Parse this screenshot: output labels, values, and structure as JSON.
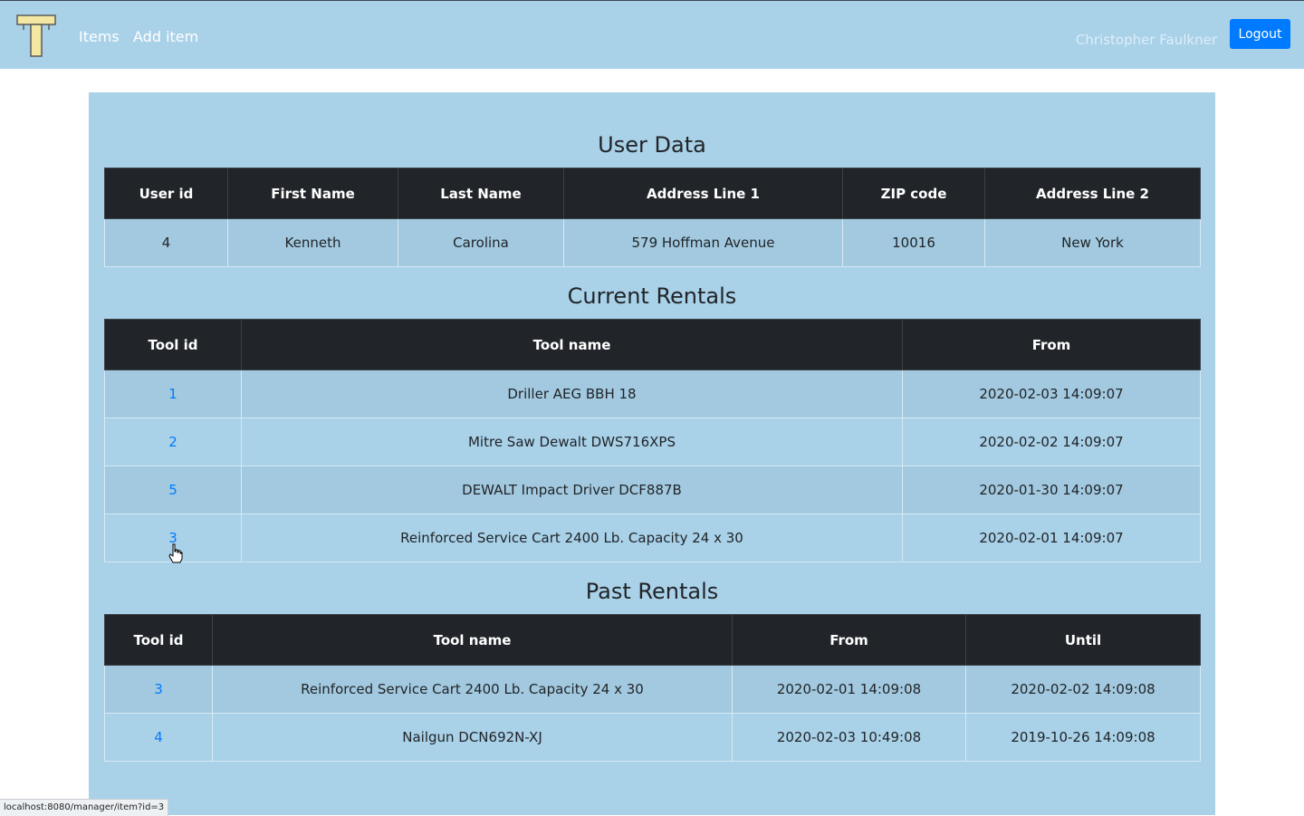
{
  "nav": {
    "logo_icon": "hammer-logo-icon",
    "items_label": "Items",
    "add_item_label": "Add item",
    "user_name": "Christopher Faulkner",
    "logout_label": "Logout"
  },
  "user_data": {
    "title": "User Data",
    "headers": [
      "User id",
      "First Name",
      "Last Name",
      "Address Line 1",
      "ZIP code",
      "Address Line 2"
    ],
    "row": [
      "4",
      "Kenneth",
      "Carolina",
      "579 Hoffman Avenue",
      "10016",
      "New York"
    ]
  },
  "current_rentals": {
    "title": "Current Rentals",
    "headers": [
      "Tool id",
      "Tool name",
      "From"
    ],
    "rows": [
      [
        "1",
        "Driller AEG BBH 18",
        "2020-02-03 14:09:07"
      ],
      [
        "2",
        "Mitre Saw Dewalt DWS716XPS",
        "2020-02-02 14:09:07"
      ],
      [
        "5",
        "DEWALT Impact Driver DCF887B",
        "2020-01-30 14:09:07"
      ],
      [
        "3",
        "Reinforced Service Cart 2400 Lb. Capacity 24 x 30",
        "2020-02-01 14:09:07"
      ]
    ]
  },
  "past_rentals": {
    "title": "Past Rentals",
    "headers": [
      "Tool id",
      "Tool name",
      "From",
      "Until"
    ],
    "rows": [
      [
        "3",
        "Reinforced Service Cart 2400 Lb. Capacity 24 x 30",
        "2020-02-01 14:09:08",
        "2020-02-02 14:09:08"
      ],
      [
        "4",
        "Nailgun DCN692N-XJ",
        "2020-02-03 10:49:08",
        "2019-10-26 14:09:08"
      ]
    ]
  },
  "status_bar": {
    "url": "localhost:8080/manager/item?id=3"
  },
  "colors": {
    "navbar_bg": "#a9d1e8",
    "panel_bg": "#a9d1e8",
    "table_header_bg": "#212529",
    "link": "#007bff",
    "logout_button": "#007bff"
  }
}
